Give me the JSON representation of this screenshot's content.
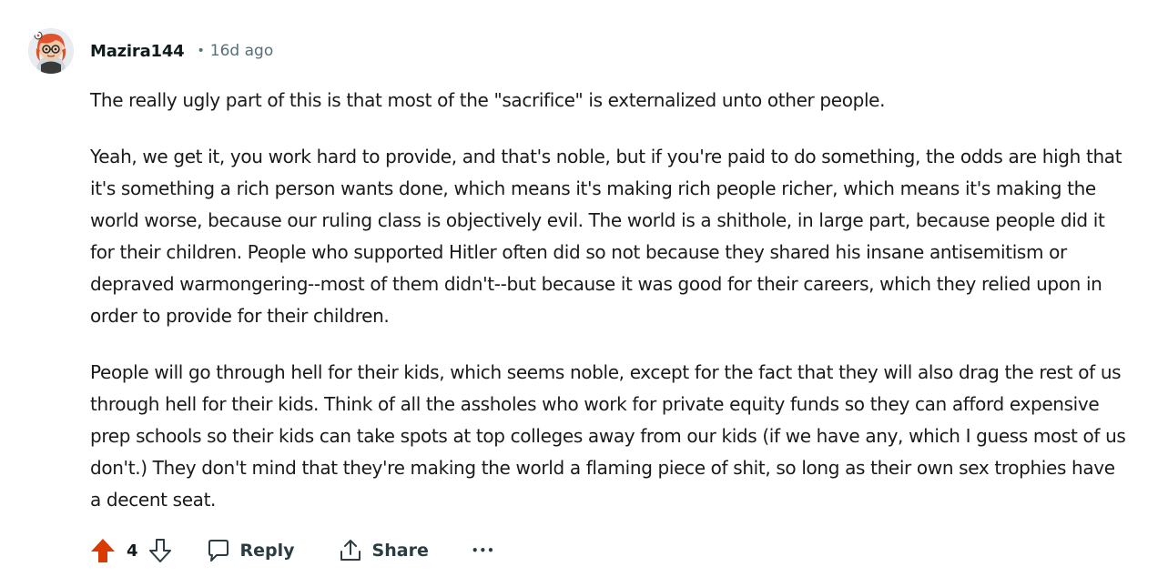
{
  "comment": {
    "author": "Mazira144",
    "separator": "•",
    "time_ago": "16d ago",
    "avatar_icon": "snoo-avatar-icon",
    "paragraphs": [
      "The really ugly part of this is that most of the \"sacrifice\" is externalized unto other people.",
      "Yeah, we get it, you work hard to provide, and that's noble, but if you're paid to do something, the odds are high that it's something a rich person wants done, which means it's making rich people richer, which means it's making the world worse, because our ruling class is objectively evil. The world is a shithole, in large part, because people did it for their children. People who supported Hitler often did so not because they shared his insane antisemitism or depraved warmongering--most of them didn't--but because it was good for their careers, which they relied upon in order to provide for their children.",
      "People will go through hell for their kids, which seems noble, except for the fact that they will also drag the rest of us through hell for their kids. Think of all the assholes who work for private equity funds so they can afford expensive prep schools so their kids can take spots at top colleges away from our kids (if we have any, which I guess most of us don't.) They don't mind that they're making the world a flaming piece of shit, so long as their own sex trophies have a decent seat."
    ]
  },
  "actions": {
    "score": "4",
    "upvoted": true,
    "upvote_color": "#d93a00",
    "reply_label": "Reply",
    "share_label": "Share",
    "more_label": "•••"
  }
}
